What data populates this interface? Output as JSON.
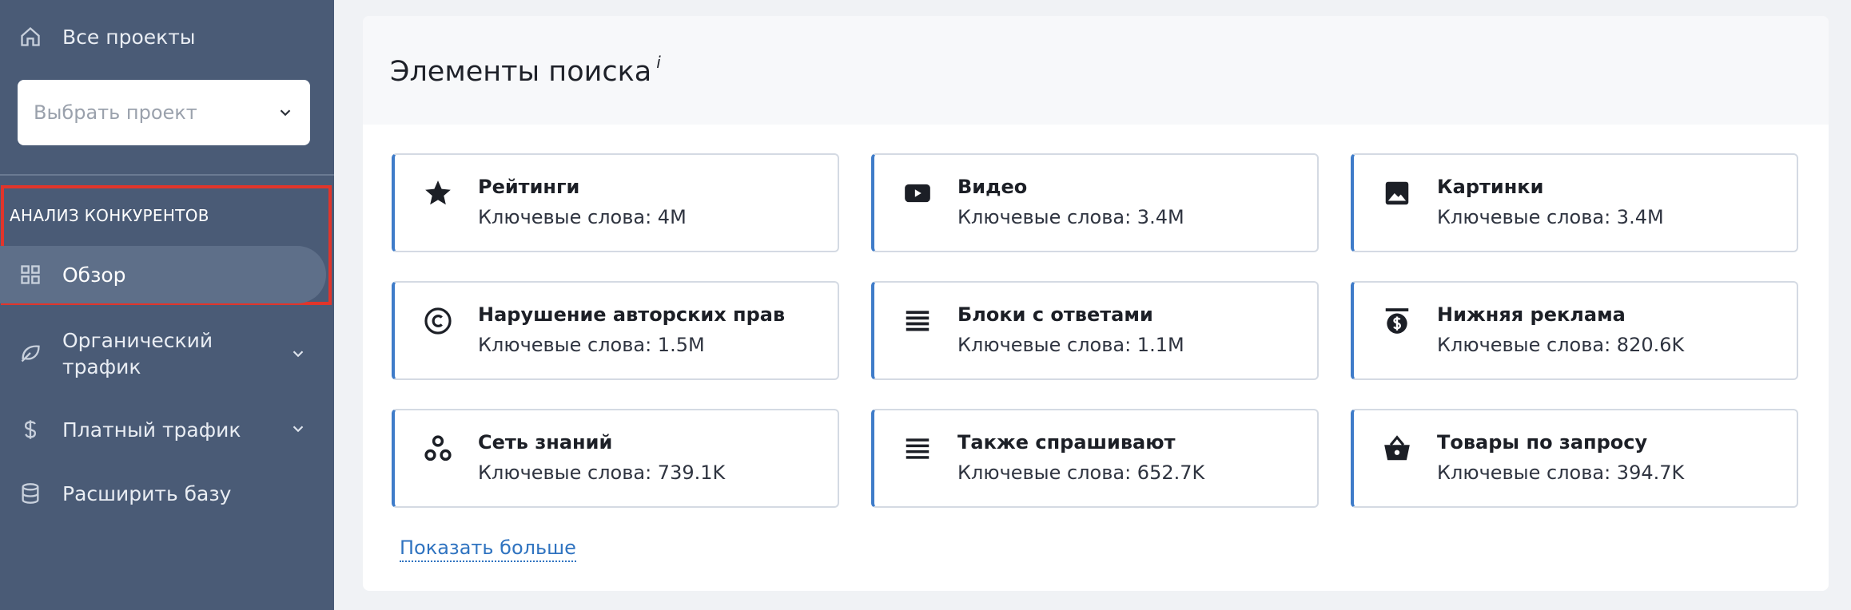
{
  "sidebar": {
    "all_projects": "Все проекты",
    "project_select_placeholder": "Выбрать проект",
    "section_title": "АНАЛИЗ КОНКУРЕНТОВ",
    "items": [
      {
        "label": "Обзор",
        "icon": "grid-icon",
        "active": true
      },
      {
        "label": "Органический\nтрафик",
        "icon": "leaf-icon",
        "expandable": true
      },
      {
        "label": "Платный трафик",
        "icon": "dollar-icon",
        "expandable": true
      },
      {
        "label": "Расширить базу",
        "icon": "database-icon"
      }
    ]
  },
  "main": {
    "title": "Элементы поиска",
    "info_marker": "i",
    "tiles": [
      {
        "name": "Рейтинги",
        "keywords": "Ключевые слова: 4M",
        "icon": "star-icon"
      },
      {
        "name": "Видео",
        "keywords": "Ключевые слова: 3.4M",
        "icon": "video-icon"
      },
      {
        "name": "Картинки",
        "keywords": "Ключевые слова: 3.4M",
        "icon": "image-icon"
      },
      {
        "name": "Нарушение авторских прав",
        "keywords": "Ключевые слова: 1.5M",
        "icon": "copyright-icon"
      },
      {
        "name": "Блоки с ответами",
        "keywords": "Ключевые слова: 1.1M",
        "icon": "answer-block-icon"
      },
      {
        "name": "Нижняя реклама",
        "keywords": "Ключевые слова: 820.6K",
        "icon": "ad-dollar-icon"
      },
      {
        "name": "Сеть знаний",
        "keywords": "Ключевые слова: 739.1K",
        "icon": "knowledge-graph-icon"
      },
      {
        "name": "Также спрашивают",
        "keywords": "Ключевые слова: 652.7K",
        "icon": "list-icon"
      },
      {
        "name": "Товары по запросу",
        "keywords": "Ключевые слова: 394.7K",
        "icon": "basket-icon"
      }
    ],
    "show_more": "Показать больше"
  },
  "colors": {
    "sidebar_bg": "#4a5b76",
    "highlight_border": "#e1352b",
    "tile_accent": "#3f7cc9",
    "link": "#2f73c0"
  }
}
